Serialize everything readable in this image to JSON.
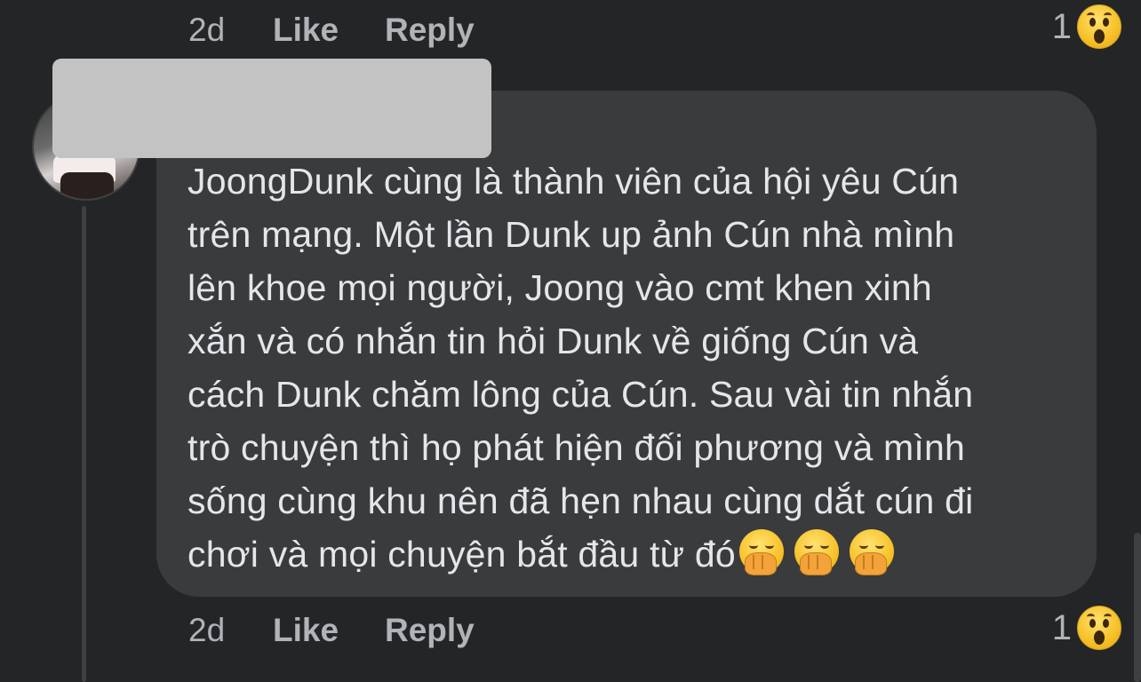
{
  "top_actions": {
    "time": "2d",
    "like": "Like",
    "reply": "Reply",
    "reaction_count": "1",
    "reaction_icon": "wow-icon"
  },
  "comment": {
    "author_redacted": true,
    "text": "JoongDunk cùng là thành viên của hội yêu Cún\ntrên mạng. Một lần Dunk up ảnh Cún nhà mình\nlên khoe mọi người, Joong vào cmt khen xinh\nxắn và có nhắn tin hỏi Dunk về giống Cún và\ncách Dunk chăm lông của Cún. Sau vài tin nhắn\ntrò chuyện thì họ phát hiện đối phương và mình\nsống cùng khu nên đã hẹn nhau cùng dắt cún đi\nchơi và mọi chuyện bắt đầu từ đó",
    "trailing_emojis": [
      "face-with-hand-over-mouth",
      "face-with-hand-over-mouth",
      "face-with-hand-over-mouth"
    ]
  },
  "bottom_actions": {
    "time": "2d",
    "like": "Like",
    "reply": "Reply",
    "reaction_count": "1",
    "reaction_icon": "wow-icon"
  },
  "colors": {
    "background": "#242526",
    "bubble": "#3a3b3c",
    "text": "#e4e6eb",
    "secondary_text": "#b0b3b8",
    "redaction": "#c3c3c3"
  }
}
